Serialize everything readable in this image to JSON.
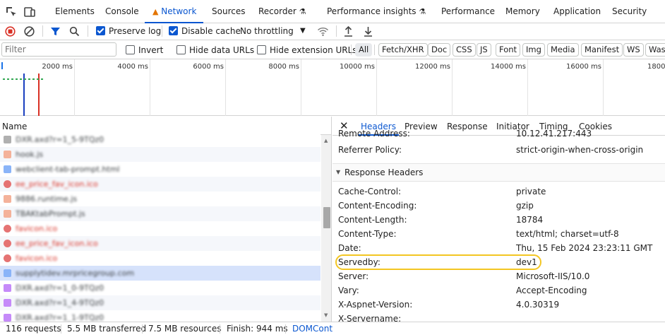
{
  "top_tabs": [
    {
      "label": "Elements"
    },
    {
      "label": "Console"
    },
    {
      "label": "Network"
    },
    {
      "label": "Sources"
    },
    {
      "label": "Recorder"
    },
    {
      "label": "Performance insights"
    },
    {
      "label": "Performance"
    },
    {
      "label": "Memory"
    },
    {
      "label": "Application"
    },
    {
      "label": "Security"
    }
  ],
  "toolbar": {
    "preserve_log": "Preserve log",
    "disable_cache": "Disable cache",
    "throttling": "No throttling"
  },
  "filter": {
    "placeholder": "Filter",
    "invert": "Invert",
    "hide_data_urls": "Hide data URLs",
    "hide_extension_urls": "Hide extension URLs",
    "types": [
      "All",
      "Fetch/XHR",
      "Doc",
      "CSS",
      "JS",
      "Font",
      "Img",
      "Media",
      "Manifest",
      "WS",
      "Was"
    ]
  },
  "timeline": {
    "ticks": [
      "2000 ms",
      "4000 ms",
      "6000 ms",
      "8000 ms",
      "10000 ms",
      "12000 ms",
      "14000 ms",
      "16000 ms",
      "18000"
    ]
  },
  "request_list": {
    "header": "Name",
    "rows": [
      {
        "name": "DXR.axd?r=1_5-9TQz0",
        "color": "#b0b0b0"
      },
      {
        "name": "hook.js",
        "color": "#f4b29a"
      },
      {
        "name": "webclient-tab-prompt.html",
        "color": "#8ab4f8"
      },
      {
        "name": "ee_price_fav_icon.ico",
        "color": "#e57373"
      },
      {
        "name": "9886.runtime.js",
        "color": "#f4b29a"
      },
      {
        "name": "TBAKtabPrompt.js",
        "color": "#f4b29a"
      },
      {
        "name": "favicon.ico",
        "color": "#e57373"
      },
      {
        "name": "ee_price_fav_icon.ico",
        "color": "#e57373"
      },
      {
        "name": "favicon.ico",
        "color": "#e57373"
      },
      {
        "name": "supplytidev.mrpricegroup.com",
        "color": "#8ab4f8"
      },
      {
        "name": "DXR.axd?r=1_0-9TQz0",
        "color": "#c58af9"
      },
      {
        "name": "DXR.axd?r=1_4-9TQz0",
        "color": "#c58af9"
      },
      {
        "name": "DXR.axd?r=1_1-9TQz0",
        "color": "#c58af9"
      }
    ]
  },
  "detail_tabs": [
    "Headers",
    "Preview",
    "Response",
    "Initiator",
    "Timing",
    "Cookies"
  ],
  "general_rows": [
    {
      "key": "Remote Address:",
      "value": "10.12.41.217:443"
    },
    {
      "key": "Referrer Policy:",
      "value": "strict-origin-when-cross-origin"
    }
  ],
  "response_headers": {
    "title": "Response Headers",
    "rows": [
      {
        "key": "Cache-Control:",
        "value": "private"
      },
      {
        "key": "Content-Encoding:",
        "value": "gzip"
      },
      {
        "key": "Content-Length:",
        "value": "18784"
      },
      {
        "key": "Content-Type:",
        "value": "text/html; charset=utf-8"
      },
      {
        "key": "Date:",
        "value": "Thu, 15 Feb 2024 23:23:11 GMT"
      },
      {
        "key": "Servedby:",
        "value": "dev1"
      },
      {
        "key": "Server:",
        "value": "Microsoft-IIS/10.0"
      },
      {
        "key": "Vary:",
        "value": "Accept-Encoding"
      },
      {
        "key": "X-Aspnet-Version:",
        "value": "4.0.30319"
      },
      {
        "key": "X-Servername:",
        "value": ""
      }
    ]
  },
  "status": {
    "requests": "116 requests",
    "transferred": "5.5 MB transferred",
    "resources": "7.5 MB resources",
    "finish": "Finish: 944 ms",
    "domcontent": "DOMCont"
  },
  "colors": {
    "accent": "#0b57d0",
    "stop": "#d93025",
    "highlight": "#f3c623"
  }
}
